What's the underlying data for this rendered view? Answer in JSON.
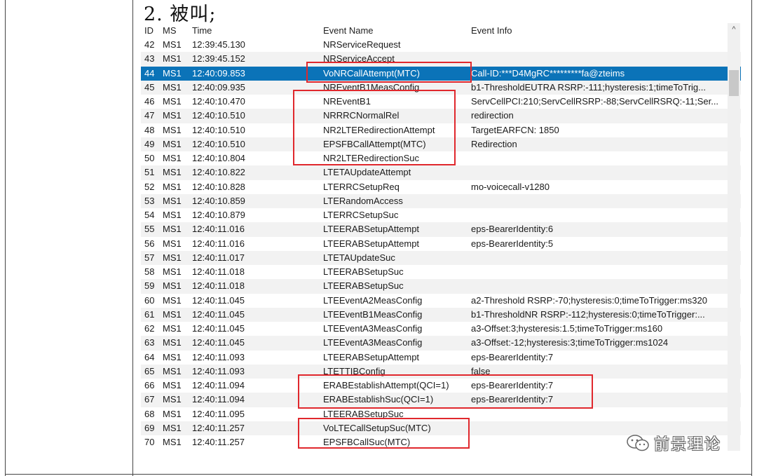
{
  "heading": "2. 被叫;",
  "columns": [
    "ID",
    "MS",
    "Time",
    "Event Name",
    "Event Info"
  ],
  "rows": [
    {
      "id": "42",
      "ms": "MS1",
      "time": "12:39:45.130",
      "event": "NRServiceRequest",
      "info": ""
    },
    {
      "id": "43",
      "ms": "MS1",
      "time": "12:39:45.152",
      "event": "NRServiceAccept",
      "info": ""
    },
    {
      "id": "44",
      "ms": "MS1",
      "time": "12:40:09.853",
      "event": "VoNRCallAttempt(MTC)",
      "info": "Call-ID:***D4MgRC*********fa@zteims"
    },
    {
      "id": "45",
      "ms": "MS1",
      "time": "12:40:09.935",
      "event": "NREventB1MeasConfig",
      "info": "b1-ThresholdEUTRA RSRP:-111;hysteresis:1;timeToTrig..."
    },
    {
      "id": "46",
      "ms": "MS1",
      "time": "12:40:10.470",
      "event": "NREventB1",
      "info": "ServCellPCI:210;ServCellRSRP:-88;ServCellRSRQ:-11;Ser..."
    },
    {
      "id": "47",
      "ms": "MS1",
      "time": "12:40:10.510",
      "event": "NRRRCNormalRel",
      "info": "redirection"
    },
    {
      "id": "48",
      "ms": "MS1",
      "time": "12:40:10.510",
      "event": "NR2LTERedirectionAttempt",
      "info": "TargetEARFCN: 1850"
    },
    {
      "id": "49",
      "ms": "MS1",
      "time": "12:40:10.510",
      "event": "EPSFBCallAttempt(MTC)",
      "info": "Redirection"
    },
    {
      "id": "50",
      "ms": "MS1",
      "time": "12:40:10.804",
      "event": "NR2LTERedirectionSuc",
      "info": ""
    },
    {
      "id": "51",
      "ms": "MS1",
      "time": "12:40:10.822",
      "event": "LTETAUpdateAttempt",
      "info": ""
    },
    {
      "id": "52",
      "ms": "MS1",
      "time": "12:40:10.828",
      "event": "LTERRCSetupReq",
      "info": "mo-voicecall-v1280"
    },
    {
      "id": "53",
      "ms": "MS1",
      "time": "12:40:10.859",
      "event": "LTERandomAccess",
      "info": ""
    },
    {
      "id": "54",
      "ms": "MS1",
      "time": "12:40:10.879",
      "event": "LTERRCSetupSuc",
      "info": ""
    },
    {
      "id": "55",
      "ms": "MS1",
      "time": "12:40:11.016",
      "event": "LTEERABSetupAttempt",
      "info": "eps-BearerIdentity:6"
    },
    {
      "id": "56",
      "ms": "MS1",
      "time": "12:40:11.016",
      "event": "LTEERABSetupAttempt",
      "info": "eps-BearerIdentity:5"
    },
    {
      "id": "57",
      "ms": "MS1",
      "time": "12:40:11.017",
      "event": "LTETAUpdateSuc",
      "info": ""
    },
    {
      "id": "58",
      "ms": "MS1",
      "time": "12:40:11.018",
      "event": "LTEERABSetupSuc",
      "info": ""
    },
    {
      "id": "59",
      "ms": "MS1",
      "time": "12:40:11.018",
      "event": "LTEERABSetupSuc",
      "info": ""
    },
    {
      "id": "60",
      "ms": "MS1",
      "time": "12:40:11.045",
      "event": "LTEEventA2MeasConfig",
      "info": "a2-Threshold RSRP:-70;hysteresis:0;timeToTrigger:ms320"
    },
    {
      "id": "61",
      "ms": "MS1",
      "time": "12:40:11.045",
      "event": "LTEEventB1MeasConfig",
      "info": "b1-ThresholdNR RSRP:-112;hysteresis:0;timeToTrigger:..."
    },
    {
      "id": "62",
      "ms": "MS1",
      "time": "12:40:11.045",
      "event": "LTEEventA3MeasConfig",
      "info": "a3-Offset:3;hysteresis:1.5;timeToTrigger:ms160"
    },
    {
      "id": "63",
      "ms": "MS1",
      "time": "12:40:11.045",
      "event": "LTEEventA3MeasConfig",
      "info": "a3-Offset:-12;hysteresis:3;timeToTrigger:ms1024"
    },
    {
      "id": "64",
      "ms": "MS1",
      "time": "12:40:11.093",
      "event": "LTEERABSetupAttempt",
      "info": "eps-BearerIdentity:7"
    },
    {
      "id": "65",
      "ms": "MS1",
      "time": "12:40:11.093",
      "event": "LTETTIBConfig",
      "info": "false"
    },
    {
      "id": "66",
      "ms": "MS1",
      "time": "12:40:11.094",
      "event": "ERABEstablishAttempt(QCI=1)",
      "info": "eps-BearerIdentity:7"
    },
    {
      "id": "67",
      "ms": "MS1",
      "time": "12:40:11.094",
      "event": "ERABEstablishSuc(QCI=1)",
      "info": "eps-BearerIdentity:7"
    },
    {
      "id": "68",
      "ms": "MS1",
      "time": "12:40:11.095",
      "event": "LTEERABSetupSuc",
      "info": ""
    },
    {
      "id": "69",
      "ms": "MS1",
      "time": "12:40:11.257",
      "event": "VoLTECallSetupSuc(MTC)",
      "info": ""
    },
    {
      "id": "70",
      "ms": "MS1",
      "time": "12:40:11.257",
      "event": "EPSFBCallSuc(MTC)",
      "info": ""
    }
  ],
  "selected_row_id": "44",
  "highlight_color": "#e0282d",
  "selection_color": "#0b73b8",
  "watermark": "前景理论",
  "icons": {
    "scroll_up": "chevron-up-icon",
    "watermark": "wechat-icon"
  }
}
